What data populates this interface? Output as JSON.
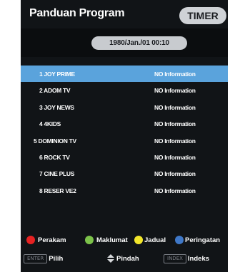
{
  "header": {
    "title": "Panduan Program",
    "timer_label": "TIMER"
  },
  "datetime": "1980/Jan./01 00:10",
  "channels": [
    {
      "name": "1 JOY PRIME",
      "info": "NO Information",
      "selected": true
    },
    {
      "name": "2 ADOM TV",
      "info": "NO Information"
    },
    {
      "name": "3 JOY NEWS",
      "info": "NO Information"
    },
    {
      "name": "4 4KIDS",
      "info": "NO Information"
    },
    {
      "name": "5 DOMINION TV",
      "info": "NO Information"
    },
    {
      "name": "6 ROCK TV",
      "info": "NO Information"
    },
    {
      "name": "7 CINE PLUS",
      "info": "NO Information"
    },
    {
      "name": "8 RESER VE2",
      "info": "NO Information"
    }
  ],
  "legend": [
    {
      "label": "Perakam",
      "color": "#e62222"
    },
    {
      "label": "Maklumat",
      "color": "#7cc24a"
    },
    {
      "label": "Jadual",
      "color": "#f2e62b"
    },
    {
      "label": "Peringatan",
      "color": "#3f78c8"
    }
  ],
  "nav": {
    "enter_key": "ENTER",
    "enter_label": "Pilih",
    "updown_label": "Pindah",
    "index_key": "INDEX",
    "index_label": "Indeks"
  },
  "colors": {
    "background": "#111417",
    "highlight": "#5aa3dc",
    "pill": "#cfd2d6"
  }
}
